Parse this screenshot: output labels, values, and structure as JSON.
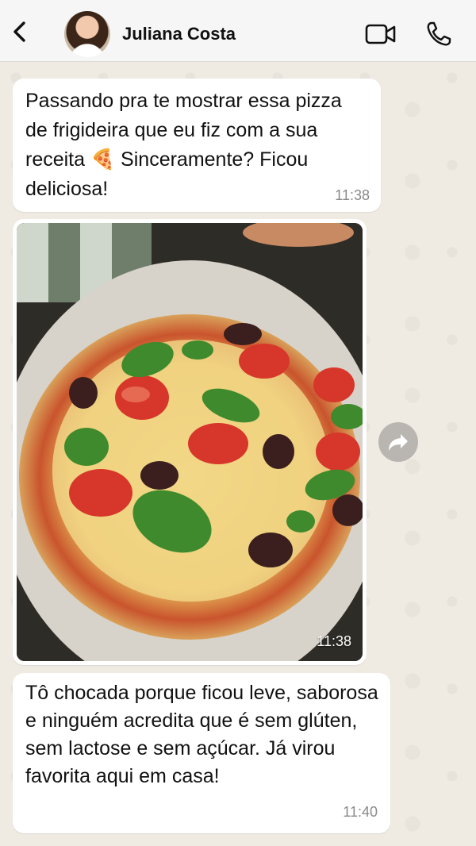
{
  "header": {
    "contact_name": "Juliana Costa",
    "back_icon": "chevron-left-icon",
    "video_icon": "video-camera-icon",
    "call_icon": "phone-icon"
  },
  "messages": [
    {
      "text": "Passando pra te mostrar essa pizza de frigideira que eu fiz com a sua receita 🍕 Sinceramente? Ficou deliciosa!",
      "time": "11:38"
    },
    {
      "type": "image",
      "image_description_icon": "pizza-photo",
      "time": "11:38"
    },
    {
      "text": "Tô chocada porque ficou leve, saborosa e ninguém acredita que é sem glúten, sem lactose e sem açúcar. Já virou favorita aqui em casa!",
      "time": "11:40"
    }
  ],
  "colors": {
    "chat_background": "#efeae2",
    "bubble": "#ffffff",
    "header": "#f6f6f6"
  }
}
